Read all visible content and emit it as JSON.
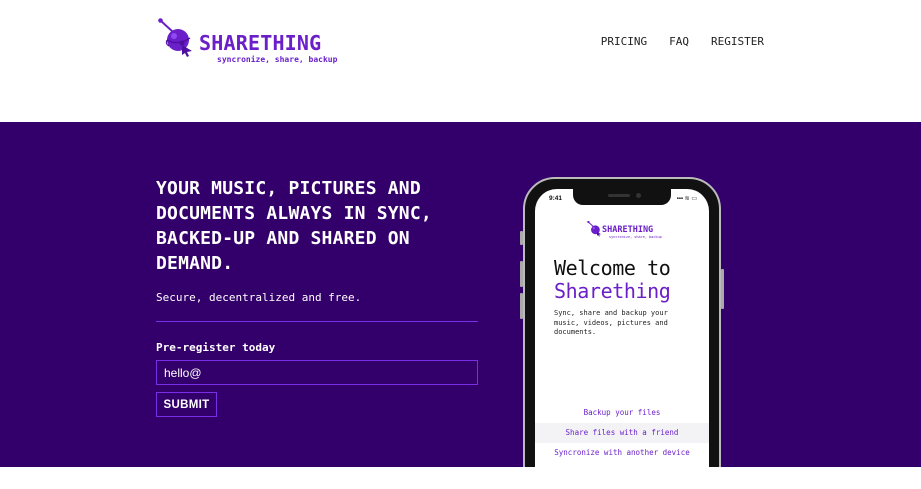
{
  "brand": {
    "name": "SHARETHING",
    "tagline": "syncronize, share, backup",
    "accent_color": "#6a1fc9",
    "hero_bg": "#33006b",
    "icon": "planet-cursor-logo"
  },
  "nav": {
    "items": [
      {
        "label": "PRICING"
      },
      {
        "label": "FAQ"
      },
      {
        "label": "REGISTER"
      }
    ]
  },
  "hero": {
    "headline": "YOUR MUSIC, PICTURES AND DOCUMENTS ALWAYS IN SYNC, BACKED-UP AND SHARED ON DEMAND.",
    "subtext": "Secure, decentralized and free.",
    "form": {
      "label": "Pre-register today",
      "email_value": "hello@",
      "submit_label": "SUBMIT"
    }
  },
  "phone": {
    "time": "9:41",
    "status": "▪▪▪ ≋ ▭",
    "app_name": "SHARETHING",
    "app_tagline": "syncronize, share, backup",
    "welcome_line1": "Welcome to",
    "welcome_line2": "Sharething",
    "description": "Sync, share and backup your music, videos, pictures and documents.",
    "menu": [
      {
        "label": "Backup your files"
      },
      {
        "label": "Share files with a friend"
      },
      {
        "label": "Syncronize with another device"
      }
    ]
  }
}
